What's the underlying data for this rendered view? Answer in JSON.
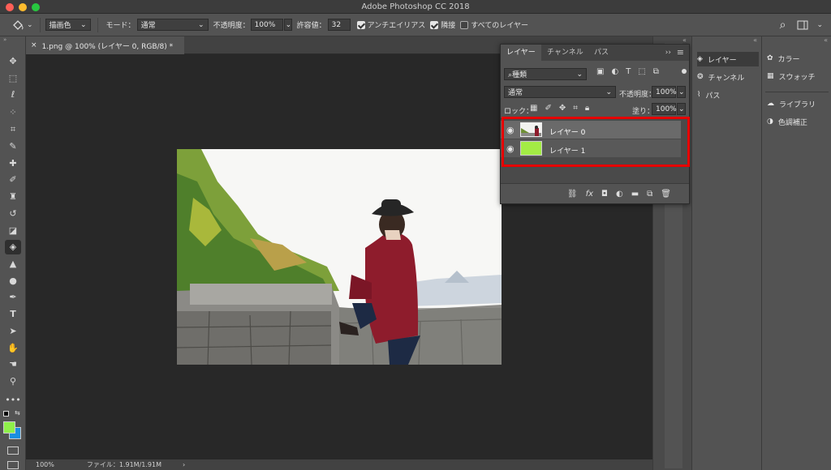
{
  "app": {
    "title": "Adobe Photoshop CC 2018"
  },
  "options": {
    "tool_preset": "描画色",
    "mode_label": "モード：",
    "mode_value": "通常",
    "opacity_label": "不透明度：",
    "opacity_value": "100%",
    "tolerance_label": "許容値：",
    "tolerance_value": "32",
    "antialias_label": "アンチエイリアス",
    "antialias_checked": true,
    "contiguous_label": "隣接",
    "contiguous_checked": true,
    "all_layers_label": "すべてのレイヤー",
    "all_layers_checked": false
  },
  "document": {
    "tab_title": "1.png @ 100% (レイヤー 0, RGB/8) *",
    "close": "×"
  },
  "status": {
    "zoom": "100%",
    "file_info": "ファイル：1.91M/1.91M",
    "arrow": "›"
  },
  "layers_panel": {
    "tabs": [
      "レイヤー",
      "チャンネル",
      "パス"
    ],
    "filter_kind": "種類",
    "blend_mode": "通常",
    "opacity_label": "不透明度：",
    "opacity_value": "100%",
    "lock_label": "ロック：",
    "fill_label": "塗り：",
    "fill_value": "100%",
    "layers": [
      {
        "name": "レイヤー 0",
        "visible": true,
        "thumb": "photo"
      },
      {
        "name": "レイヤー 1",
        "visible": true,
        "thumb": "#a3ec45"
      }
    ]
  },
  "dock": {
    "group1": [
      "レイヤー",
      "チャンネル",
      "パス"
    ],
    "group2": [
      "カラー",
      "スウォッチ"
    ],
    "group3": [
      "ライブラリ",
      "色調補正"
    ]
  },
  "colors": {
    "foreground": "#8ff04a",
    "background": "#1a8fe0",
    "highlight_box": "#e60000",
    "green_layer": "#a3ec45"
  },
  "icons": {
    "toolbar": [
      "move-icon",
      "marquee-icon",
      "lasso-icon",
      "quick-select-icon",
      "crop-icon",
      "eyedropper-icon",
      "healing-icon",
      "brush-icon",
      "stamp-icon",
      "history-brush-icon",
      "eraser-icon",
      "paint-bucket-icon",
      "blur-icon",
      "dodge-icon",
      "pen-icon",
      "type-icon",
      "path-select-icon",
      "shape-icon",
      "hand-icon",
      "zoom-icon",
      "more-icon"
    ]
  }
}
